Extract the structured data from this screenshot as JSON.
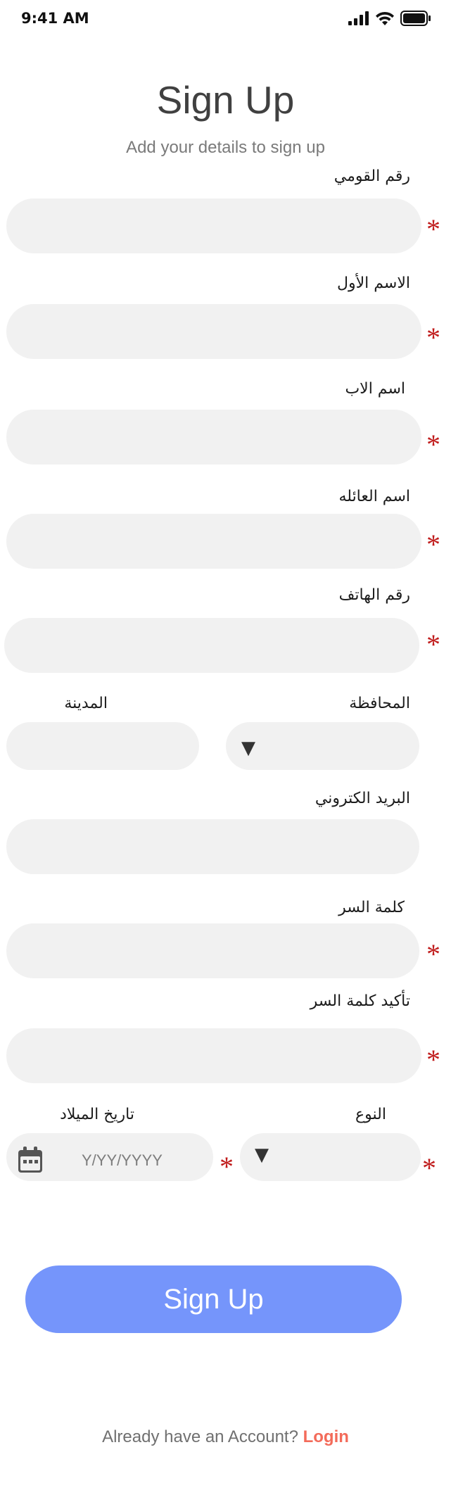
{
  "status_bar": {
    "time": "9:41 AM"
  },
  "header": {
    "title": "Sign Up",
    "subtitle": "Add your details to sign up"
  },
  "form": {
    "national_id": {
      "label": "رقم القومي",
      "required_mark": "*"
    },
    "first_name": {
      "label": "الاسم الأول",
      "required_mark": "*"
    },
    "father_name": {
      "label": "اسم الاب",
      "required_mark": "*"
    },
    "family_name": {
      "label": "اسم العائله",
      "required_mark": "*"
    },
    "phone": {
      "label": "رقم الهاتف",
      "required_mark": "*"
    },
    "governorate": {
      "label": "المحافظة",
      "caret": "▼"
    },
    "city": {
      "label": "المدينة"
    },
    "email": {
      "label": "البريد الكتروني"
    },
    "password": {
      "label": "كلمة السر",
      "required_mark": "*"
    },
    "confirm_password": {
      "label": "تأكيد كلمة السر",
      "required_mark": "*"
    },
    "gender": {
      "label": "النوع",
      "caret": "▼",
      "required_mark": "*"
    },
    "birth_date": {
      "label": "تاريخ الميلاد",
      "placeholder": "Y/YY/YYYY",
      "required_mark": "*"
    }
  },
  "actions": {
    "submit_label": "Sign Up"
  },
  "footer": {
    "prompt": "Already have an Account? ",
    "login_label": "Login"
  },
  "colors": {
    "accent": "#7595fb",
    "link": "#f36b5a",
    "required": "#c01b1b",
    "field_bg": "#f1f1f1"
  },
  "icons": [
    "cellular-signal-icon",
    "wifi-icon",
    "battery-icon",
    "calendar-icon",
    "dropdown-caret-icon"
  ]
}
